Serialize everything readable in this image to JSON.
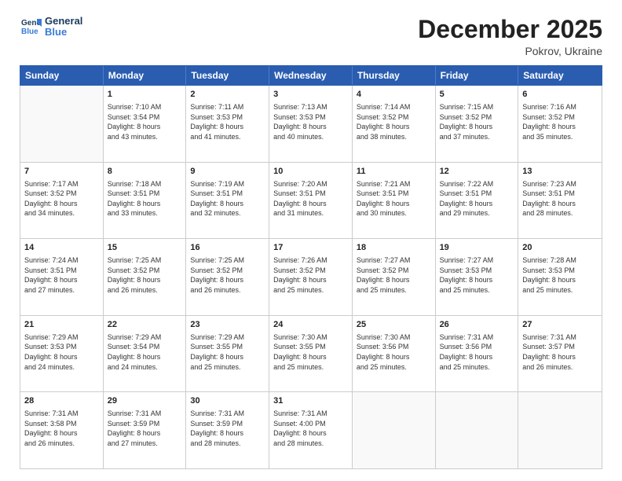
{
  "header": {
    "logo_line1": "General",
    "logo_line2": "Blue",
    "month": "December 2025",
    "location": "Pokrov, Ukraine"
  },
  "weekdays": [
    "Sunday",
    "Monday",
    "Tuesday",
    "Wednesday",
    "Thursday",
    "Friday",
    "Saturday"
  ],
  "rows": [
    [
      {
        "day": "",
        "lines": []
      },
      {
        "day": "1",
        "lines": [
          "Sunrise: 7:10 AM",
          "Sunset: 3:54 PM",
          "Daylight: 8 hours",
          "and 43 minutes."
        ]
      },
      {
        "day": "2",
        "lines": [
          "Sunrise: 7:11 AM",
          "Sunset: 3:53 PM",
          "Daylight: 8 hours",
          "and 41 minutes."
        ]
      },
      {
        "day": "3",
        "lines": [
          "Sunrise: 7:13 AM",
          "Sunset: 3:53 PM",
          "Daylight: 8 hours",
          "and 40 minutes."
        ]
      },
      {
        "day": "4",
        "lines": [
          "Sunrise: 7:14 AM",
          "Sunset: 3:52 PM",
          "Daylight: 8 hours",
          "and 38 minutes."
        ]
      },
      {
        "day": "5",
        "lines": [
          "Sunrise: 7:15 AM",
          "Sunset: 3:52 PM",
          "Daylight: 8 hours",
          "and 37 minutes."
        ]
      },
      {
        "day": "6",
        "lines": [
          "Sunrise: 7:16 AM",
          "Sunset: 3:52 PM",
          "Daylight: 8 hours",
          "and 35 minutes."
        ]
      }
    ],
    [
      {
        "day": "7",
        "lines": [
          "Sunrise: 7:17 AM",
          "Sunset: 3:52 PM",
          "Daylight: 8 hours",
          "and 34 minutes."
        ]
      },
      {
        "day": "8",
        "lines": [
          "Sunrise: 7:18 AM",
          "Sunset: 3:51 PM",
          "Daylight: 8 hours",
          "and 33 minutes."
        ]
      },
      {
        "day": "9",
        "lines": [
          "Sunrise: 7:19 AM",
          "Sunset: 3:51 PM",
          "Daylight: 8 hours",
          "and 32 minutes."
        ]
      },
      {
        "day": "10",
        "lines": [
          "Sunrise: 7:20 AM",
          "Sunset: 3:51 PM",
          "Daylight: 8 hours",
          "and 31 minutes."
        ]
      },
      {
        "day": "11",
        "lines": [
          "Sunrise: 7:21 AM",
          "Sunset: 3:51 PM",
          "Daylight: 8 hours",
          "and 30 minutes."
        ]
      },
      {
        "day": "12",
        "lines": [
          "Sunrise: 7:22 AM",
          "Sunset: 3:51 PM",
          "Daylight: 8 hours",
          "and 29 minutes."
        ]
      },
      {
        "day": "13",
        "lines": [
          "Sunrise: 7:23 AM",
          "Sunset: 3:51 PM",
          "Daylight: 8 hours",
          "and 28 minutes."
        ]
      }
    ],
    [
      {
        "day": "14",
        "lines": [
          "Sunrise: 7:24 AM",
          "Sunset: 3:51 PM",
          "Daylight: 8 hours",
          "and 27 minutes."
        ]
      },
      {
        "day": "15",
        "lines": [
          "Sunrise: 7:25 AM",
          "Sunset: 3:52 PM",
          "Daylight: 8 hours",
          "and 26 minutes."
        ]
      },
      {
        "day": "16",
        "lines": [
          "Sunrise: 7:25 AM",
          "Sunset: 3:52 PM",
          "Daylight: 8 hours",
          "and 26 minutes."
        ]
      },
      {
        "day": "17",
        "lines": [
          "Sunrise: 7:26 AM",
          "Sunset: 3:52 PM",
          "Daylight: 8 hours",
          "and 25 minutes."
        ]
      },
      {
        "day": "18",
        "lines": [
          "Sunrise: 7:27 AM",
          "Sunset: 3:52 PM",
          "Daylight: 8 hours",
          "and 25 minutes."
        ]
      },
      {
        "day": "19",
        "lines": [
          "Sunrise: 7:27 AM",
          "Sunset: 3:53 PM",
          "Daylight: 8 hours",
          "and 25 minutes."
        ]
      },
      {
        "day": "20",
        "lines": [
          "Sunrise: 7:28 AM",
          "Sunset: 3:53 PM",
          "Daylight: 8 hours",
          "and 25 minutes."
        ]
      }
    ],
    [
      {
        "day": "21",
        "lines": [
          "Sunrise: 7:29 AM",
          "Sunset: 3:53 PM",
          "Daylight: 8 hours",
          "and 24 minutes."
        ]
      },
      {
        "day": "22",
        "lines": [
          "Sunrise: 7:29 AM",
          "Sunset: 3:54 PM",
          "Daylight: 8 hours",
          "and 24 minutes."
        ]
      },
      {
        "day": "23",
        "lines": [
          "Sunrise: 7:29 AM",
          "Sunset: 3:55 PM",
          "Daylight: 8 hours",
          "and 25 minutes."
        ]
      },
      {
        "day": "24",
        "lines": [
          "Sunrise: 7:30 AM",
          "Sunset: 3:55 PM",
          "Daylight: 8 hours",
          "and 25 minutes."
        ]
      },
      {
        "day": "25",
        "lines": [
          "Sunrise: 7:30 AM",
          "Sunset: 3:56 PM",
          "Daylight: 8 hours",
          "and 25 minutes."
        ]
      },
      {
        "day": "26",
        "lines": [
          "Sunrise: 7:31 AM",
          "Sunset: 3:56 PM",
          "Daylight: 8 hours",
          "and 25 minutes."
        ]
      },
      {
        "day": "27",
        "lines": [
          "Sunrise: 7:31 AM",
          "Sunset: 3:57 PM",
          "Daylight: 8 hours",
          "and 26 minutes."
        ]
      }
    ],
    [
      {
        "day": "28",
        "lines": [
          "Sunrise: 7:31 AM",
          "Sunset: 3:58 PM",
          "Daylight: 8 hours",
          "and 26 minutes."
        ]
      },
      {
        "day": "29",
        "lines": [
          "Sunrise: 7:31 AM",
          "Sunset: 3:59 PM",
          "Daylight: 8 hours",
          "and 27 minutes."
        ]
      },
      {
        "day": "30",
        "lines": [
          "Sunrise: 7:31 AM",
          "Sunset: 3:59 PM",
          "Daylight: 8 hours",
          "and 28 minutes."
        ]
      },
      {
        "day": "31",
        "lines": [
          "Sunrise: 7:31 AM",
          "Sunset: 4:00 PM",
          "Daylight: 8 hours",
          "and 28 minutes."
        ]
      },
      {
        "day": "",
        "lines": []
      },
      {
        "day": "",
        "lines": []
      },
      {
        "day": "",
        "lines": []
      }
    ]
  ]
}
